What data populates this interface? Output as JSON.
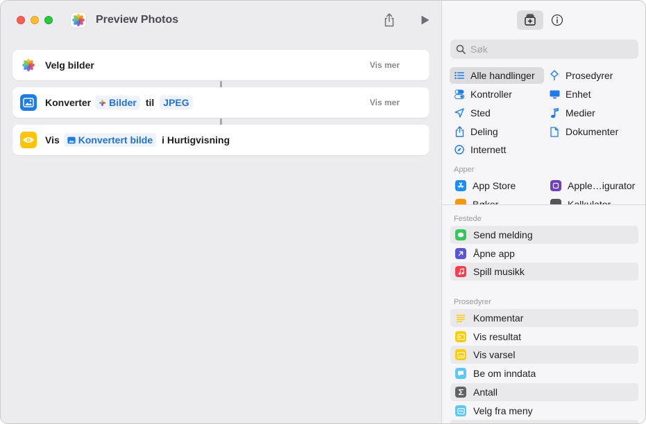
{
  "window": {
    "title": "Preview Photos"
  },
  "workflow": {
    "actions": [
      {
        "label": "Velg bilder",
        "show_more": "Vis mer"
      },
      {
        "label": "Konverter",
        "token1": "Bilder",
        "connector": "til",
        "token2": "JPEG",
        "show_more": "Vis mer"
      },
      {
        "label": "Vis",
        "token1": "Konvertert bilde",
        "suffix": "i Hurtigvisning"
      }
    ]
  },
  "sidebar": {
    "search_placeholder": "Søk",
    "categories": [
      {
        "label": "Alle handlinger",
        "icon": "list-icon",
        "selected": true
      },
      {
        "label": "Prosedyrer",
        "icon": "scripting-icon"
      },
      {
        "label": "Kontroller",
        "icon": "toggle-icon"
      },
      {
        "label": "Enhet",
        "icon": "display-icon"
      },
      {
        "label": "Sted",
        "icon": "location-arrow-icon"
      },
      {
        "label": "Medier",
        "icon": "music-note-icon"
      },
      {
        "label": "Deling",
        "icon": "share-icon"
      },
      {
        "label": "Dokumenter",
        "icon": "document-icon"
      },
      {
        "label": "Internett",
        "icon": "compass-icon"
      }
    ],
    "apps_header": "Apper",
    "apps": [
      {
        "label": "App Store",
        "color": "#1a8cf5"
      },
      {
        "label": "Apple…igurator",
        "color": "#6e3fc3"
      },
      {
        "label": "Bøker",
        "color": "#ff9500"
      },
      {
        "label": "Kalkulator",
        "color": "#555555"
      }
    ],
    "pinned_header": "Festede",
    "pinned": [
      {
        "label": "Send melding",
        "color": "#34c759",
        "icon": "message-icon"
      },
      {
        "label": "Åpne app",
        "color": "#5856d6",
        "icon": "arrow-up-right-icon"
      },
      {
        "label": "Spill musikk",
        "color": "#fa3c4c",
        "icon": "music-note-icon"
      }
    ],
    "scripting_header": "Prosedyrer",
    "scripting": [
      {
        "label": "Kommentar",
        "color": "#ffcc00",
        "icon": "lines-icon"
      },
      {
        "label": "Vis resultat",
        "color": "#ffcc00",
        "icon": "result-icon"
      },
      {
        "label": "Vis varsel",
        "color": "#ffcc00",
        "icon": "alert-icon"
      },
      {
        "label": "Be om inndata",
        "color": "#5ac8fa",
        "icon": "chat-icon"
      },
      {
        "label": "Antall",
        "color": "#636366",
        "icon": "sigma-icon"
      },
      {
        "label": "Velg fra meny",
        "color": "#5ac8fa",
        "icon": "menu-icon"
      }
    ]
  }
}
